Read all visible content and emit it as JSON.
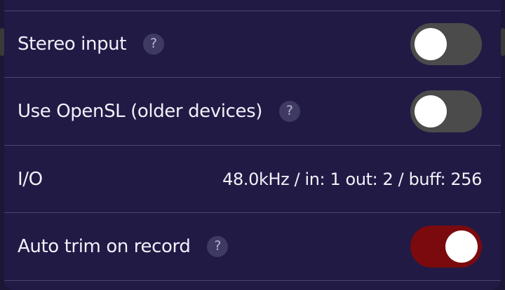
{
  "settings": {
    "rows": [
      {
        "label": "Stereo input",
        "help": "?",
        "toggle": "off"
      },
      {
        "label": "Use OpenSL (older devices)",
        "help": "?",
        "toggle": "off"
      },
      {
        "label": "I/O",
        "value": "48.0kHz / in: 1  out: 2 / buff: 256"
      },
      {
        "label": "Auto trim on record",
        "help": "?",
        "toggle": "on"
      }
    ]
  },
  "colors": {
    "panel_bg": "#211a45",
    "toggle_off": "#4b4b4b",
    "toggle_on": "#7a0a0e",
    "divider": "#4a4470"
  }
}
